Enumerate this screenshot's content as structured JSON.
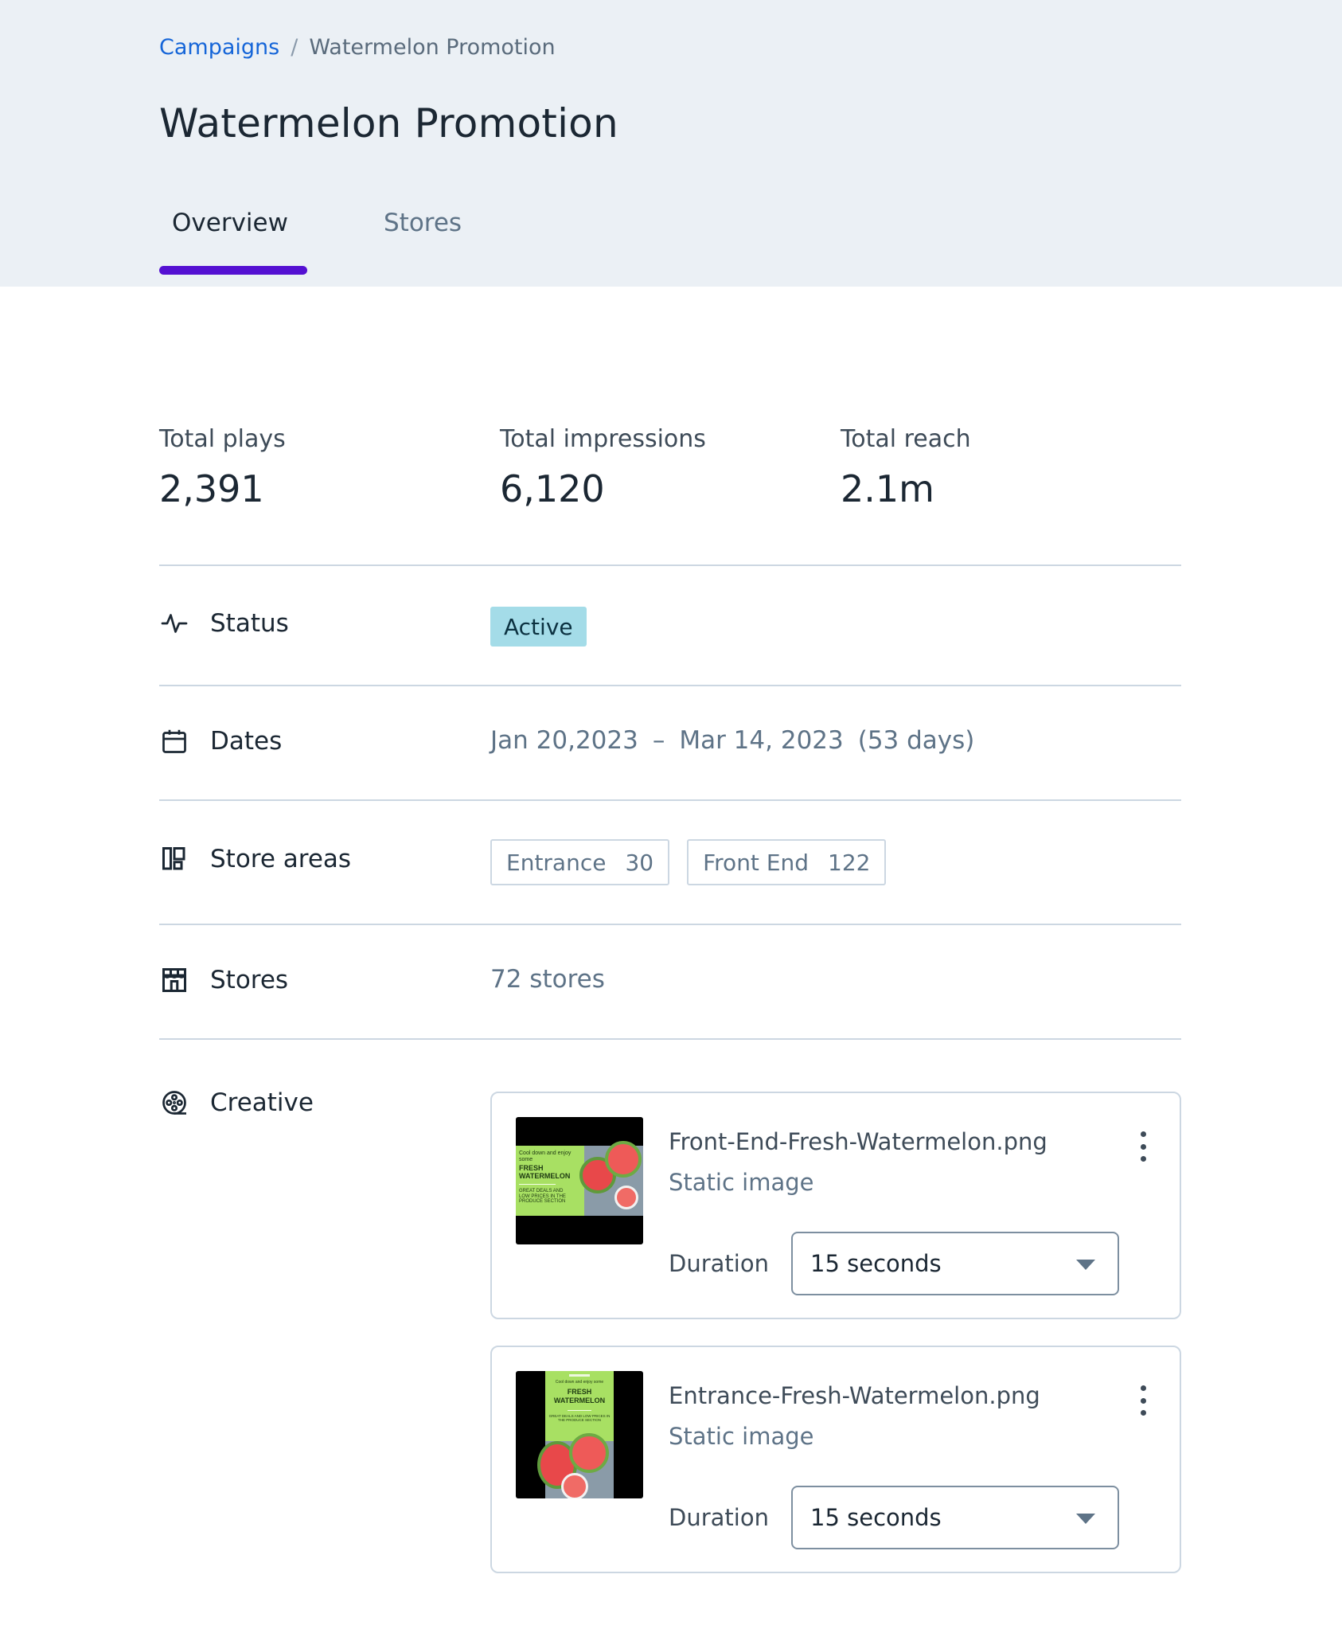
{
  "breadcrumb": {
    "parent": "Campaigns",
    "separator": "/",
    "current": "Watermelon Promotion"
  },
  "page": {
    "title": "Watermelon Promotion"
  },
  "tabs": [
    {
      "label": "Overview",
      "active": true
    },
    {
      "label": "Stores",
      "active": false
    }
  ],
  "stats": [
    {
      "label": "Total plays",
      "value": "2,391"
    },
    {
      "label": "Total impressions",
      "value": "6,120"
    },
    {
      "label": "Total reach",
      "value": "2.1m"
    }
  ],
  "details": {
    "status": {
      "label": "Status",
      "icon": "activity-icon",
      "value": "Active",
      "badge_color": "#A4DCE8"
    },
    "dates": {
      "label": "Dates",
      "icon": "calendar-icon",
      "start": "Jan 20,2023",
      "separator": "–",
      "end": "Mar 14, 2023",
      "duration": "(53 days)"
    },
    "store_areas": {
      "label": "Store areas",
      "icon": "layout-icon",
      "chips": [
        {
          "name": "Entrance",
          "count": "30"
        },
        {
          "name": "Front End",
          "count": "122"
        }
      ]
    },
    "stores": {
      "label": "Stores",
      "icon": "storefront-icon",
      "value": "72 stores"
    },
    "creative": {
      "label": "Creative",
      "icon": "film-reel-icon",
      "items": [
        {
          "file_name": "Front-End-Fresh-Watermelon.png",
          "type": "Static image",
          "duration_label": "Duration",
          "duration_value": "15 seconds",
          "thumb_text": {
            "line1": "Cool down and enjoy some",
            "headline1": "FRESH",
            "headline2": "WATERMELON",
            "sub": "GREAT DEALS AND LOW PRICES IN THE PRODUCE SECTION"
          }
        },
        {
          "file_name": "Entrance-Fresh-Watermelon.png",
          "type": "Static image",
          "duration_label": "Duration",
          "duration_value": "15 seconds",
          "thumb_text": {
            "line1": "Cool down and enjoy some",
            "headline1": "FRESH",
            "headline2": "WATERMELON",
            "sub": "GREAT DEALS AND LOW PRICES IN THE PRODUCE SECTION"
          }
        }
      ]
    }
  },
  "colors": {
    "header_bg": "#EBF0F5",
    "link": "#1565D8",
    "tab_indicator": "#5410D2",
    "divider": "#CCD7E2",
    "muted_text": "#5E7387",
    "primary_text": "#1B2733"
  }
}
